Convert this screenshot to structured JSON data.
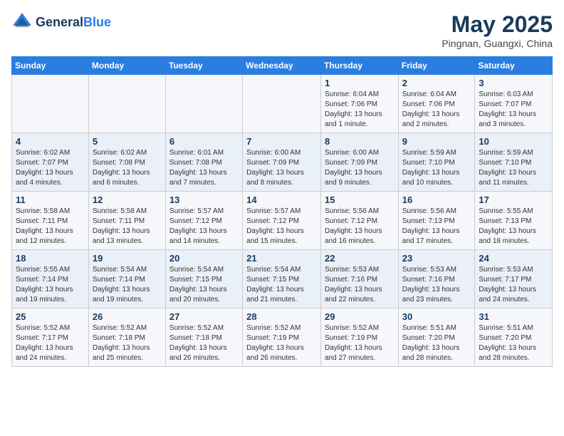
{
  "header": {
    "logo_general": "General",
    "logo_blue": "Blue",
    "month_title": "May 2025",
    "location": "Pingnan, Guangxi, China"
  },
  "weekdays": [
    "Sunday",
    "Monday",
    "Tuesday",
    "Wednesday",
    "Thursday",
    "Friday",
    "Saturday"
  ],
  "weeks": [
    [
      {
        "day": "",
        "info": ""
      },
      {
        "day": "",
        "info": ""
      },
      {
        "day": "",
        "info": ""
      },
      {
        "day": "",
        "info": ""
      },
      {
        "day": "1",
        "info": "Sunrise: 6:04 AM\nSunset: 7:06 PM\nDaylight: 13 hours and 1 minute."
      },
      {
        "day": "2",
        "info": "Sunrise: 6:04 AM\nSunset: 7:06 PM\nDaylight: 13 hours and 2 minutes."
      },
      {
        "day": "3",
        "info": "Sunrise: 6:03 AM\nSunset: 7:07 PM\nDaylight: 13 hours and 3 minutes."
      }
    ],
    [
      {
        "day": "4",
        "info": "Sunrise: 6:02 AM\nSunset: 7:07 PM\nDaylight: 13 hours and 4 minutes."
      },
      {
        "day": "5",
        "info": "Sunrise: 6:02 AM\nSunset: 7:08 PM\nDaylight: 13 hours and 6 minutes."
      },
      {
        "day": "6",
        "info": "Sunrise: 6:01 AM\nSunset: 7:08 PM\nDaylight: 13 hours and 7 minutes."
      },
      {
        "day": "7",
        "info": "Sunrise: 6:00 AM\nSunset: 7:09 PM\nDaylight: 13 hours and 8 minutes."
      },
      {
        "day": "8",
        "info": "Sunrise: 6:00 AM\nSunset: 7:09 PM\nDaylight: 13 hours and 9 minutes."
      },
      {
        "day": "9",
        "info": "Sunrise: 5:59 AM\nSunset: 7:10 PM\nDaylight: 13 hours and 10 minutes."
      },
      {
        "day": "10",
        "info": "Sunrise: 5:59 AM\nSunset: 7:10 PM\nDaylight: 13 hours and 11 minutes."
      }
    ],
    [
      {
        "day": "11",
        "info": "Sunrise: 5:58 AM\nSunset: 7:11 PM\nDaylight: 13 hours and 12 minutes."
      },
      {
        "day": "12",
        "info": "Sunrise: 5:58 AM\nSunset: 7:11 PM\nDaylight: 13 hours and 13 minutes."
      },
      {
        "day": "13",
        "info": "Sunrise: 5:57 AM\nSunset: 7:12 PM\nDaylight: 13 hours and 14 minutes."
      },
      {
        "day": "14",
        "info": "Sunrise: 5:57 AM\nSunset: 7:12 PM\nDaylight: 13 hours and 15 minutes."
      },
      {
        "day": "15",
        "info": "Sunrise: 5:56 AM\nSunset: 7:12 PM\nDaylight: 13 hours and 16 minutes."
      },
      {
        "day": "16",
        "info": "Sunrise: 5:56 AM\nSunset: 7:13 PM\nDaylight: 13 hours and 17 minutes."
      },
      {
        "day": "17",
        "info": "Sunrise: 5:55 AM\nSunset: 7:13 PM\nDaylight: 13 hours and 18 minutes."
      }
    ],
    [
      {
        "day": "18",
        "info": "Sunrise: 5:55 AM\nSunset: 7:14 PM\nDaylight: 13 hours and 19 minutes."
      },
      {
        "day": "19",
        "info": "Sunrise: 5:54 AM\nSunset: 7:14 PM\nDaylight: 13 hours and 19 minutes."
      },
      {
        "day": "20",
        "info": "Sunrise: 5:54 AM\nSunset: 7:15 PM\nDaylight: 13 hours and 20 minutes."
      },
      {
        "day": "21",
        "info": "Sunrise: 5:54 AM\nSunset: 7:15 PM\nDaylight: 13 hours and 21 minutes."
      },
      {
        "day": "22",
        "info": "Sunrise: 5:53 AM\nSunset: 7:16 PM\nDaylight: 13 hours and 22 minutes."
      },
      {
        "day": "23",
        "info": "Sunrise: 5:53 AM\nSunset: 7:16 PM\nDaylight: 13 hours and 23 minutes."
      },
      {
        "day": "24",
        "info": "Sunrise: 5:53 AM\nSunset: 7:17 PM\nDaylight: 13 hours and 24 minutes."
      }
    ],
    [
      {
        "day": "25",
        "info": "Sunrise: 5:52 AM\nSunset: 7:17 PM\nDaylight: 13 hours and 24 minutes."
      },
      {
        "day": "26",
        "info": "Sunrise: 5:52 AM\nSunset: 7:18 PM\nDaylight: 13 hours and 25 minutes."
      },
      {
        "day": "27",
        "info": "Sunrise: 5:52 AM\nSunset: 7:18 PM\nDaylight: 13 hours and 26 minutes."
      },
      {
        "day": "28",
        "info": "Sunrise: 5:52 AM\nSunset: 7:19 PM\nDaylight: 13 hours and 26 minutes."
      },
      {
        "day": "29",
        "info": "Sunrise: 5:52 AM\nSunset: 7:19 PM\nDaylight: 13 hours and 27 minutes."
      },
      {
        "day": "30",
        "info": "Sunrise: 5:51 AM\nSunset: 7:20 PM\nDaylight: 13 hours and 28 minutes."
      },
      {
        "day": "31",
        "info": "Sunrise: 5:51 AM\nSunset: 7:20 PM\nDaylight: 13 hours and 28 minutes."
      }
    ]
  ]
}
